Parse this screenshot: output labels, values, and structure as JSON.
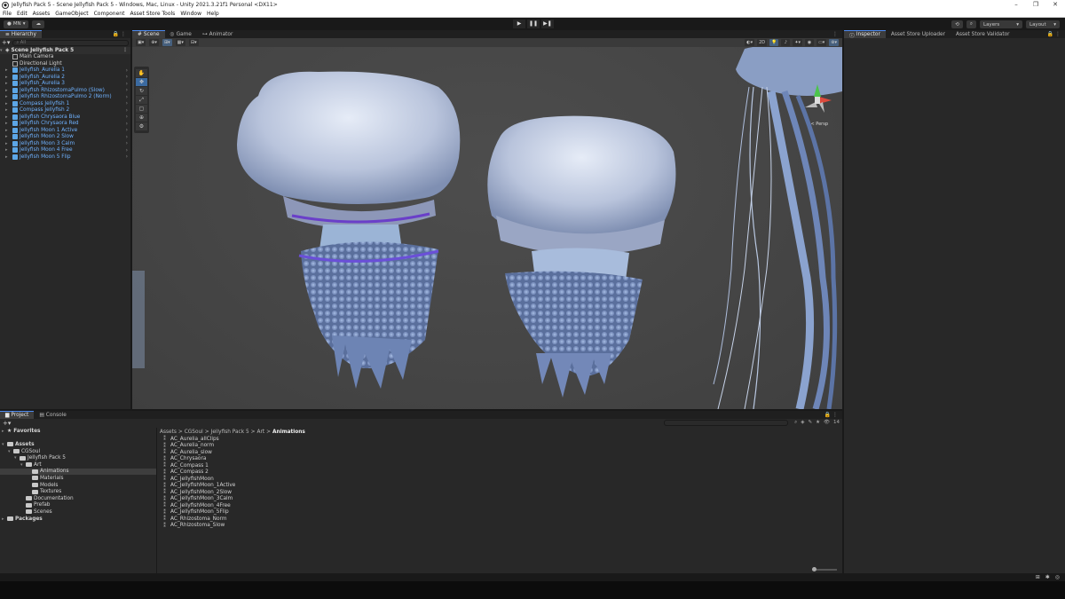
{
  "window": {
    "title": "Jellyfish Pack 5 - Scene Jellyfish Pack 5 - Windows, Mac, Linux - Unity 2021.3.21f1 Personal <DX11>",
    "controls": [
      "–",
      "❐",
      "✕"
    ]
  },
  "menu": [
    "File",
    "Edit",
    "Assets",
    "GameObject",
    "Component",
    "Asset Store Tools",
    "Window",
    "Help"
  ],
  "toolbar": {
    "account": "MN",
    "layers": "Layers",
    "layout": "Layout",
    "play": "▶",
    "pause": "❚❚",
    "step": "▶❚"
  },
  "hierarchy": {
    "tab": "Hierarchy",
    "search_placeholder": "All",
    "scene": "Scene Jellyfish Pack 5",
    "items": [
      {
        "name": "Main Camera",
        "type": "go"
      },
      {
        "name": "Directional Light",
        "type": "go"
      },
      {
        "name": "Jellyfish_Aurelia 1",
        "type": "prefab"
      },
      {
        "name": "Jellyfish_Aurelia 2",
        "type": "prefab"
      },
      {
        "name": "Jellyfish_Aurelia 3",
        "type": "prefab"
      },
      {
        "name": "Jellyfish RhizostomaPulmo (Slow)",
        "type": "prefab"
      },
      {
        "name": "Jellyfish RhizostomaPulmo 2 (Norm)",
        "type": "prefab"
      },
      {
        "name": "Compass Jellyfish 1",
        "type": "prefab"
      },
      {
        "name": "Compass Jellyfish 2",
        "type": "prefab"
      },
      {
        "name": "Jellyfish Chrysaora Blue",
        "type": "prefab"
      },
      {
        "name": "Jellyfish Chrysaora Red",
        "type": "prefab"
      },
      {
        "name": "Jellyfish Moon 1 Active",
        "type": "prefab"
      },
      {
        "name": "Jellyfish Moon 2 Slow",
        "type": "prefab"
      },
      {
        "name": "Jellyfish Moon 3 Calm",
        "type": "prefab"
      },
      {
        "name": "Jellyfish Moon 4 Free",
        "type": "prefab"
      },
      {
        "name": "Jellyfish Moon 5 Flip",
        "type": "prefab"
      }
    ]
  },
  "scene_tabs": [
    "Scene",
    "Game",
    "Animator"
  ],
  "scene_toolbar": {
    "mode_2d": "2D"
  },
  "gizmo": {
    "label": "< Persp"
  },
  "inspector_tabs": [
    "Inspector",
    "Asset Store Uploader",
    "Asset Store Validator"
  ],
  "project": {
    "tabs": [
      "Project",
      "Console"
    ],
    "tree": [
      {
        "label": "Favorites",
        "depth": 0,
        "kind": "star",
        "bold": true
      },
      {
        "label": "",
        "depth": 0,
        "kind": "spacer"
      },
      {
        "label": "Assets",
        "depth": 0,
        "kind": "folder",
        "bold": true
      },
      {
        "label": "CGSoul",
        "depth": 1,
        "kind": "folder"
      },
      {
        "label": "Jellyfish Pack 5",
        "depth": 2,
        "kind": "folder"
      },
      {
        "label": "Art",
        "depth": 3,
        "kind": "folder"
      },
      {
        "label": "Animations",
        "depth": 4,
        "kind": "folder",
        "selected": true
      },
      {
        "label": "Materials",
        "depth": 4,
        "kind": "folder"
      },
      {
        "label": "Models",
        "depth": 4,
        "kind": "folder"
      },
      {
        "label": "Textures",
        "depth": 4,
        "kind": "folder"
      },
      {
        "label": "Documentation",
        "depth": 3,
        "kind": "folder"
      },
      {
        "label": "Prefab",
        "depth": 3,
        "kind": "folder"
      },
      {
        "label": "Scenes",
        "depth": 3,
        "kind": "folder"
      },
      {
        "label": "Packages",
        "depth": 0,
        "kind": "folder",
        "bold": true
      }
    ],
    "breadcrumb": [
      "Assets",
      "CGSoul",
      "Jellyfish Pack 5",
      "Art",
      "Animations"
    ],
    "files": [
      "AC_Aurelia_allClips",
      "AC_Aurelia_norm",
      "AC_Aurelia_slow",
      "AC_Chrysaora",
      "AC_Compass 1",
      "AC_Compass 2",
      "AC_JellyfishMoon",
      "AC_JellyfishMoon_1Active",
      "AC_JellyfishMoon_2Slow",
      "AC_JellyfishMoon_3Calm",
      "AC_JellyfishMoon_4Free",
      "AC_JellyfishMoon_5Flip",
      "AC_Rhizostoma_Norm",
      "AC_Rhizostoma_Slow"
    ],
    "hidden_count": "14"
  },
  "colors": {
    "accent": "#4d8af0",
    "prefab": "#6fb2ff",
    "panel": "#282828"
  }
}
